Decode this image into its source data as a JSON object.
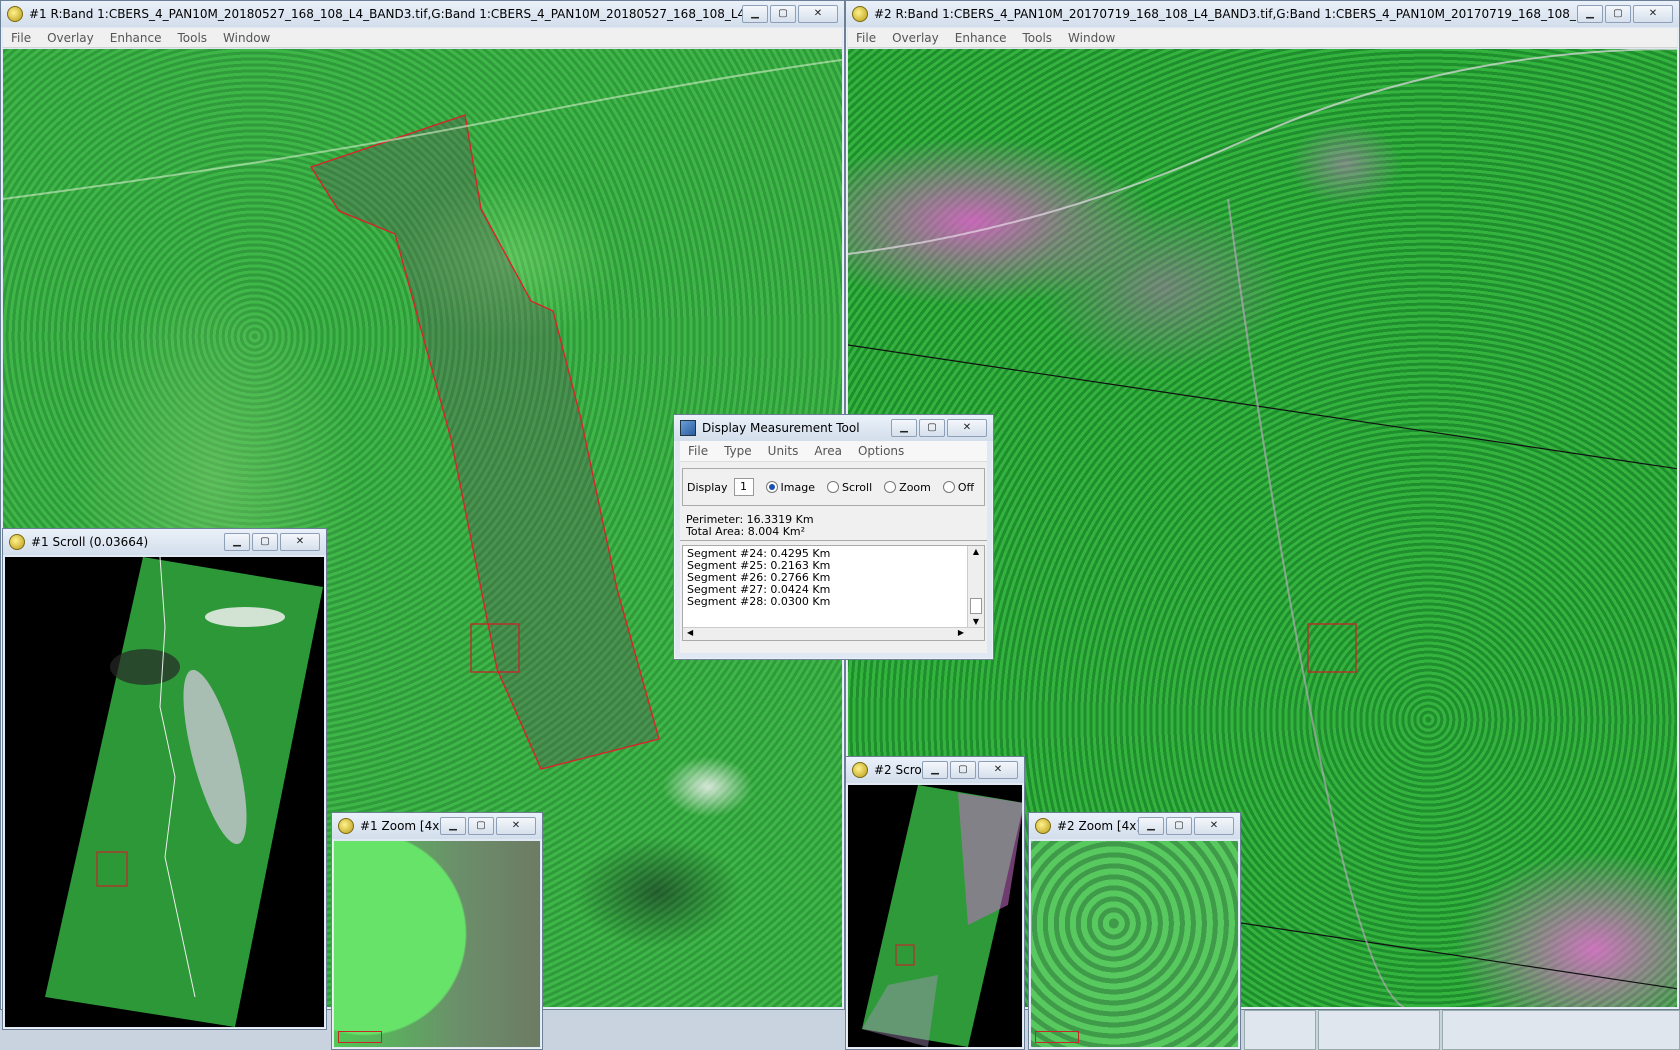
{
  "windows": {
    "image1": {
      "title": "#1 R:Band 1:CBERS_4_PAN10M_20180527_168_108_L4_BAND3.tif,G:Band 1:CBERS_4_PAN10M_20180527_168_108_L4_BAND4.tif,B:B...",
      "menu": [
        "File",
        "Overlay",
        "Enhance",
        "Tools",
        "Window"
      ]
    },
    "image2": {
      "title": "#2 R:Band 1:CBERS_4_PAN10M_20170719_168_108_L4_BAND3.tif,G:Band 1:CBERS_4_PAN10M_20170719_168_108_L4_BAND4.tif,B:...",
      "menu": [
        "File",
        "Overlay",
        "Enhance",
        "Tools",
        "Window"
      ]
    },
    "scroll1": {
      "title": "#1 Scroll (0.03664)"
    },
    "zoom1": {
      "title": "#1 Zoom [4x]"
    },
    "scroll2": {
      "title": "#2 Scro..."
    },
    "zoom2": {
      "title": "#2 Zoom [4x]"
    }
  },
  "measurement_tool": {
    "title": "Display Measurement Tool",
    "menu": [
      "File",
      "Type",
      "Units",
      "Area",
      "Options"
    ],
    "display_label": "Display",
    "display_value": "1",
    "modes": [
      {
        "label": "Image",
        "selected": true
      },
      {
        "label": "Scroll",
        "selected": false
      },
      {
        "label": "Zoom",
        "selected": false
      },
      {
        "label": "Off",
        "selected": false
      }
    ],
    "perimeter": "Perimeter: 16.3319 Km",
    "total_area": "Total Area: 8.004 Km²",
    "segments": [
      "Segment #24: 0.4295 Km",
      "Segment #25: 0.2163 Km",
      "Segment #26: 0.2766 Km",
      "Segment #27: 0.0424 Km",
      "Segment #28: 0.0300 Km"
    ]
  }
}
